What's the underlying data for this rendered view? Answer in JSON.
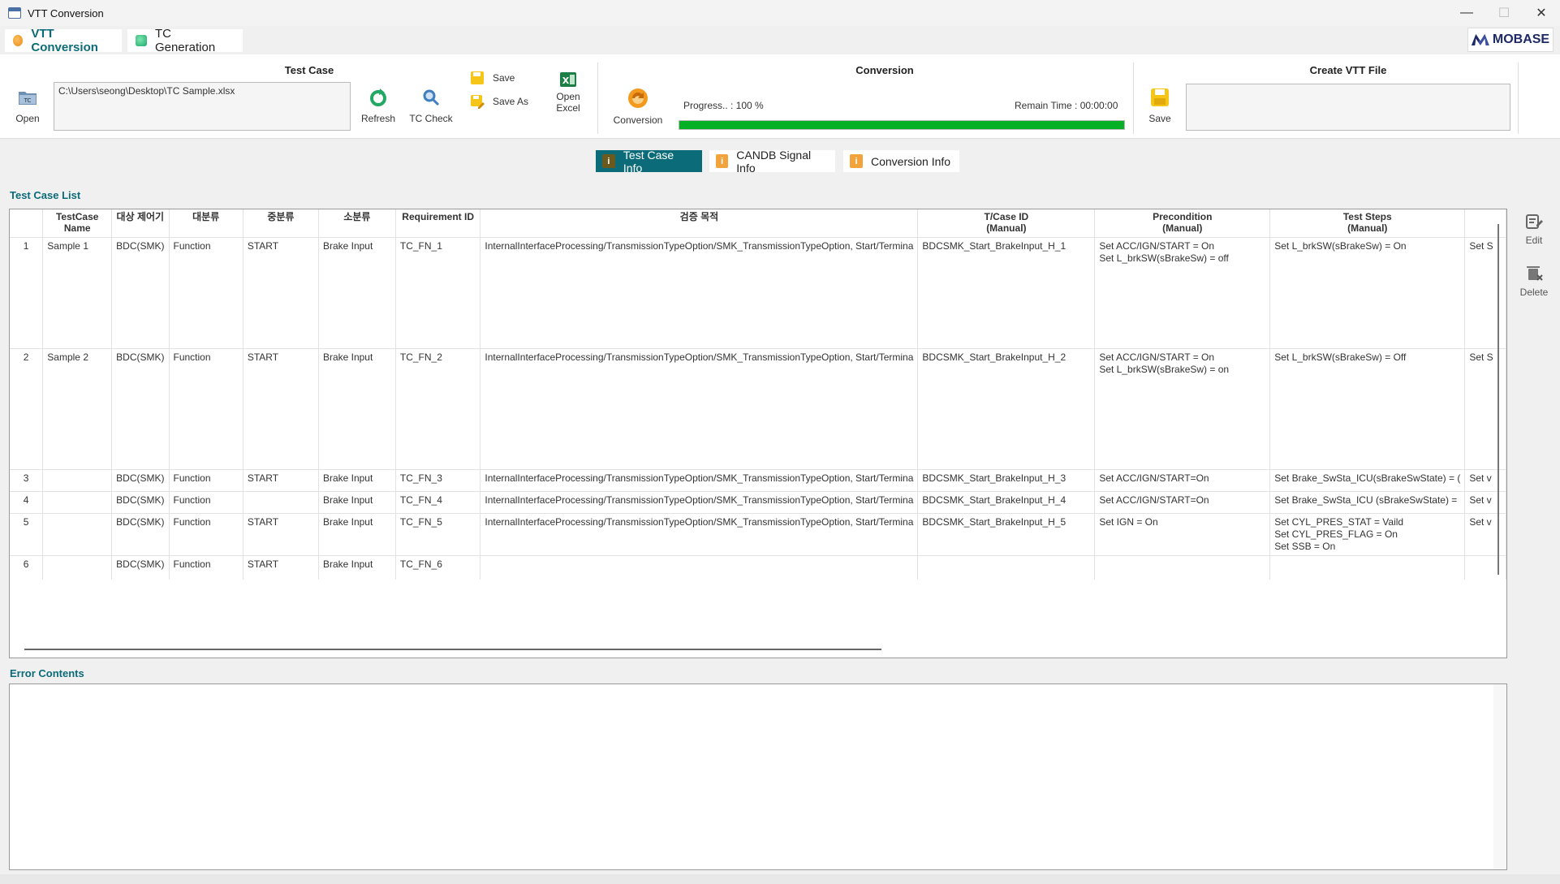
{
  "window": {
    "title": "VTT Conversion",
    "controls": {
      "minimize": "—",
      "maximize": "☐",
      "close": "✕"
    }
  },
  "tabs": [
    {
      "label": "VTT Conversion",
      "active": true,
      "icon": "conversion-icon"
    },
    {
      "label": "TC Generation",
      "active": false,
      "icon": "generation-icon"
    }
  ],
  "logo": "MOBASE",
  "ribbon": {
    "test_case": {
      "title": "Test Case",
      "open_label": "Open",
      "path": "C:\\Users\\seong\\Desktop\\TC Sample.xlsx",
      "refresh_label": "Refresh",
      "tc_check_label": "TC Check",
      "save_label": "Save",
      "save_as_label": "Save As",
      "open_excel_label_1": "Open",
      "open_excel_label_2": "Excel"
    },
    "conversion": {
      "title": "Conversion",
      "button_label": "Conversion",
      "progress_text": "Progress.. : 100 %",
      "progress": 100,
      "remain_text": "Remain Time : 00:00:00",
      "progress_color": "#06b025"
    },
    "create_vtt": {
      "title": "Create VTT File",
      "save_label": "Save"
    }
  },
  "info_tabs": [
    {
      "label": "Test Case Info",
      "active": true
    },
    {
      "label": "CANDB Signal Info",
      "active": false
    },
    {
      "label": "Conversion Info",
      "active": false
    }
  ],
  "test_case_list": {
    "label": "Test Case List",
    "columns": [
      "",
      "TestCase\nName",
      "대상 제어기",
      "대분류",
      "중분류",
      "소분류",
      "Requirement ID",
      "검증 목적",
      "T/Case ID\n(Manual)",
      "Precondition\n(Manual)",
      "Test Steps\n(Manual)",
      ""
    ],
    "rows": [
      {
        "no": "1",
        "name": "Sample 1",
        "target": "BDC(SMK)",
        "major": "Function",
        "mid": "START",
        "minor": "Brake Input",
        "req_id": "TC_FN_1",
        "purpose": "InternalInterfaceProcessing/TransmissionTypeOption/SMK_TransmissionTypeOption, Start/Termina",
        "tc_id": "BDCSMK_Start_BrakeInput_H_1",
        "precondition": "Set ACC/IGN/START = On\nSet L_brkSW(sBrakeSw) = off",
        "steps": "Set L_brkSW(sBrakeSw) = On",
        "extra": "Set S"
      },
      {
        "no": "2",
        "name": "Sample 2",
        "target": "BDC(SMK)",
        "major": "Function",
        "mid": "START",
        "minor": "Brake Input",
        "req_id": "TC_FN_2",
        "purpose": "InternalInterfaceProcessing/TransmissionTypeOption/SMK_TransmissionTypeOption, Start/Termina",
        "tc_id": "BDCSMK_Start_BrakeInput_H_2",
        "precondition": "Set ACC/IGN/START = On\nSet L_brkSW(sBrakeSw) = on",
        "steps": "Set L_brkSW(sBrakeSw) = Off",
        "extra": "Set S"
      },
      {
        "no": "3",
        "name": "",
        "target": "BDC(SMK)",
        "major": "Function",
        "mid": "START",
        "minor": "Brake Input",
        "req_id": "TC_FN_3",
        "purpose": "InternalInterfaceProcessing/TransmissionTypeOption/SMK_TransmissionTypeOption, Start/Termina",
        "tc_id": "BDCSMK_Start_BrakeInput_H_3",
        "precondition": "Set ACC/IGN/START=On",
        "steps": "Set Brake_SwSta_ICU(sBrakeSwState) = (",
        "extra": "Set v"
      },
      {
        "no": "4",
        "name": "",
        "target": "BDC(SMK)",
        "major": "Function",
        "mid": "",
        "minor": "Brake Input",
        "req_id": "TC_FN_4",
        "purpose": "InternalInterfaceProcessing/TransmissionTypeOption/SMK_TransmissionTypeOption, Start/Termina",
        "tc_id": "BDCSMK_Start_BrakeInput_H_4",
        "precondition": "Set ACC/IGN/START=On",
        "steps": "Set Brake_SwSta_ICU (sBrakeSwState) =",
        "extra": "Set v"
      },
      {
        "no": "5",
        "name": "",
        "target": "BDC(SMK)",
        "major": "Function",
        "mid": "START",
        "minor": "Brake Input",
        "req_id": "TC_FN_5",
        "purpose": "InternalInterfaceProcessing/TransmissionTypeOption/SMK_TransmissionTypeOption, Start/Termina",
        "tc_id": "BDCSMK_Start_BrakeInput_H_5",
        "precondition": "Set IGN = On",
        "steps": "Set CYL_PRES_STAT = Vaild\nSet CYL_PRES_FLAG = On\nSet SSB = On",
        "extra": "Set v"
      },
      {
        "no": "6",
        "name": "",
        "target": "BDC(SMK)",
        "major": "Function",
        "mid": "START",
        "minor": "Brake Input",
        "req_id": "TC_FN_6",
        "purpose": "",
        "tc_id": "",
        "precondition": "",
        "steps": "",
        "extra": ""
      }
    ]
  },
  "side_actions": {
    "edit_label": "Edit",
    "delete_label": "Delete"
  },
  "error_contents": {
    "label": "Error Contents",
    "text": ""
  }
}
